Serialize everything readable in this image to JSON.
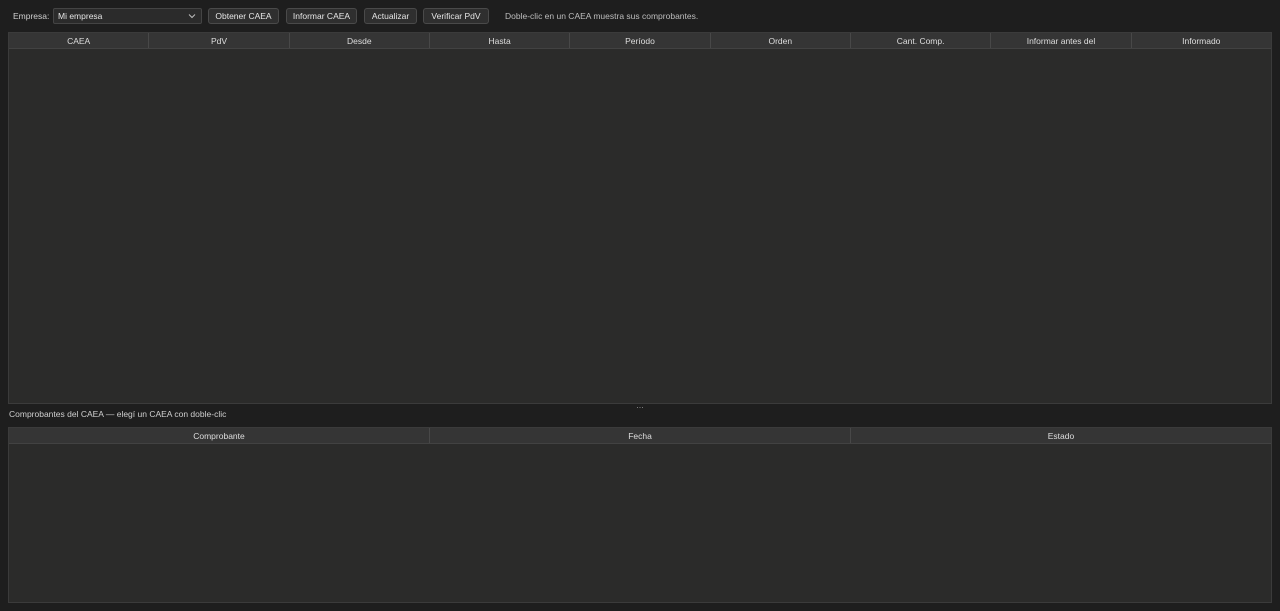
{
  "toolbar": {
    "empresa_label": "Empresa:",
    "empresa_value": "Mi empresa",
    "btn_obtener": "Obtener CAEA",
    "btn_informar": "Informar CAEA",
    "btn_actualizar": "Actualizar",
    "btn_verificar": "Verificar PdV",
    "hint": "Doble-clic en un CAEA muestra sus comprobantes."
  },
  "caea_table": {
    "columns": [
      "CAEA",
      "PdV",
      "Desde",
      "Hasta",
      "Período",
      "Orden",
      "Cant. Comp.",
      "Informar antes del",
      "Informado"
    ],
    "rows": []
  },
  "splitter_glyph": "…",
  "comprobantes": {
    "label": "Comprobantes del CAEA — elegí un CAEA con doble-clic",
    "columns": [
      "Comprobante",
      "Fecha",
      "Estado"
    ],
    "rows": []
  },
  "colors": {
    "background": "#1e1e1e",
    "panel": "#2b2b2a",
    "header": "#353535"
  }
}
